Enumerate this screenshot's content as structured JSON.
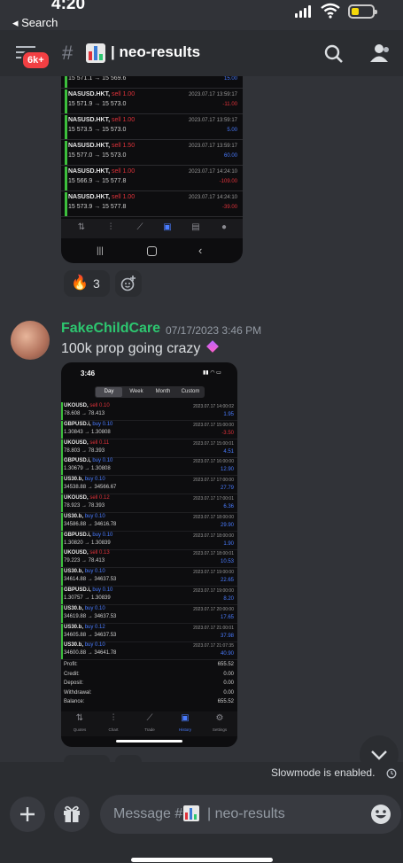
{
  "status_bar": {
    "time": "4:20",
    "back_label": "◂ Search"
  },
  "header": {
    "badge": "6k+",
    "channel_name": "| neo-results"
  },
  "first_image": {
    "rows": [
      {
        "symbol": "",
        "side": "",
        "prices": "15 571.1 → 15 569.6",
        "time": "",
        "pl": "15.00",
        "pl_color": "#4a7cff"
      },
      {
        "symbol": "NASUSD.HKT,",
        "side": "sell 1.00",
        "prices": "15 571.9 → 15 573.0",
        "time": "2023.07.17 13:59:17",
        "pl": "-11.00",
        "pl_color": "#e0323a"
      },
      {
        "symbol": "NASUSD.HKT,",
        "side": "sell 1.00",
        "prices": "15 573.5 → 15 573.0",
        "time": "2023.07.17 13:59:17",
        "pl": "5.00",
        "pl_color": "#4a7cff"
      },
      {
        "symbol": "NASUSD.HKT,",
        "side": "sell 1.50",
        "prices": "15 577.0 → 15 573.0",
        "time": "2023.07.17 13:59:17",
        "pl": "60.00",
        "pl_color": "#4a7cff"
      },
      {
        "symbol": "NASUSD.HKT,",
        "side": "sell 1.00",
        "prices": "15 566.9 → 15 577.8",
        "time": "2023.07.17 14:24:10",
        "pl": "-109.00",
        "pl_color": "#e0323a"
      },
      {
        "symbol": "NASUSD.HKT,",
        "side": "sell 1.00",
        "prices": "15 573.9 → 15 577.8",
        "time": "2023.07.17 14:24:10",
        "pl": "-39.00",
        "pl_color": "#e0323a"
      }
    ]
  },
  "reactions": [
    {
      "emoji": "🔥",
      "count": "3"
    }
  ],
  "message": {
    "author": "FakeChildCare",
    "timestamp": "07/17/2023 3:46 PM",
    "text": "100k prop going crazy"
  },
  "second_image": {
    "time": "3:46",
    "tabs": [
      "Day",
      "Week",
      "Month",
      "Custom"
    ],
    "rows": [
      {
        "symbol": "UKOUSD,",
        "side": "sell 0.10",
        "side_color": "#e0323a",
        "prices": "78.608 → 78.413",
        "time": "2023.07.17 14:00:02",
        "pl": "1.95"
      },
      {
        "symbol": "GBPUSD.i,",
        "side": "buy 0.10",
        "side_color": "#4a7cff",
        "prices": "1.30843 → 1.30808",
        "time": "2023.07.17 15:00:00",
        "pl": "-3.50"
      },
      {
        "symbol": "UKOUSD,",
        "side": "sell 0.11",
        "side_color": "#e0323a",
        "prices": "78.803 → 78.393",
        "time": "2023.07.17 15:00:01",
        "pl": "4.51"
      },
      {
        "symbol": "GBPUSD.i,",
        "side": "buy 0.10",
        "side_color": "#4a7cff",
        "prices": "1.30679 → 1.30808",
        "time": "2023.07.17 16:00:00",
        "pl": "12.90"
      },
      {
        "symbol": "US30.b,",
        "side": "buy 0.10",
        "side_color": "#4a7cff",
        "prices": "34538.88 → 34566.67",
        "time": "2023.07.17 17:00:00",
        "pl": "27.79"
      },
      {
        "symbol": "UKOUSD,",
        "side": "sell 0.12",
        "side_color": "#e0323a",
        "prices": "78.923 → 78.393",
        "time": "2023.07.17 17:00:01",
        "pl": "6.36"
      },
      {
        "symbol": "US30.b,",
        "side": "buy 0.10",
        "side_color": "#4a7cff",
        "prices": "34586.88 → 34616.78",
        "time": "2023.07.17 18:00:00",
        "pl": "29.90"
      },
      {
        "symbol": "GBPUSD.i,",
        "side": "buy 0.10",
        "side_color": "#4a7cff",
        "prices": "1.30820 → 1.30839",
        "time": "2023.07.17 18:00:00",
        "pl": "1.90"
      },
      {
        "symbol": "UKOUSD,",
        "side": "sell 0.13",
        "side_color": "#e0323a",
        "prices": "79.223 → 78.413",
        "time": "2023.07.17 18:00:01",
        "pl": "10.53"
      },
      {
        "symbol": "US30.b,",
        "side": "buy 0.10",
        "side_color": "#4a7cff",
        "prices": "34614.88 → 34637.53",
        "time": "2023.07.17 19:00:00",
        "pl": "22.65"
      },
      {
        "symbol": "GBPUSD.i,",
        "side": "buy 0.10",
        "side_color": "#4a7cff",
        "prices": "1.30757 → 1.30839",
        "time": "2023.07.17 19:00:00",
        "pl": "8.20"
      },
      {
        "symbol": "US30.b,",
        "side": "buy 0.10",
        "side_color": "#4a7cff",
        "prices": "34619.88 → 34637.53",
        "time": "2023.07.17 20:00:00",
        "pl": "17.65"
      },
      {
        "symbol": "US30.b,",
        "side": "buy 0.12",
        "side_color": "#4a7cff",
        "prices": "34605.88 → 34637.53",
        "time": "2023.07.17 21:00:01",
        "pl": "37.98"
      },
      {
        "symbol": "US30.b,",
        "side": "buy 0.10",
        "side_color": "#4a7cff",
        "prices": "34600.88 → 34641.78",
        "time": "2023.07.17 21:07:35",
        "pl": "40.90"
      }
    ],
    "summary": [
      {
        "label": "Profit:",
        "value": "655.52"
      },
      {
        "label": "Credit:",
        "value": "0.00"
      },
      {
        "label": "Deposit:",
        "value": "0.00"
      },
      {
        "label": "Withdrawal:",
        "value": "0.00"
      },
      {
        "label": "Balance:",
        "value": "655.52"
      }
    ],
    "nav": [
      "Quotes",
      "Chart",
      "Trade",
      "History",
      "Settings"
    ]
  },
  "slowmode_text": "Slowmode is enabled.",
  "composer": {
    "placeholder_prefix": "Message #",
    "placeholder_suffix": "| neo-results"
  },
  "colors": {
    "author": "#2dc770",
    "background": "#313338",
    "profit_blue": "#4a7cff",
    "loss_red": "#e0323a"
  }
}
